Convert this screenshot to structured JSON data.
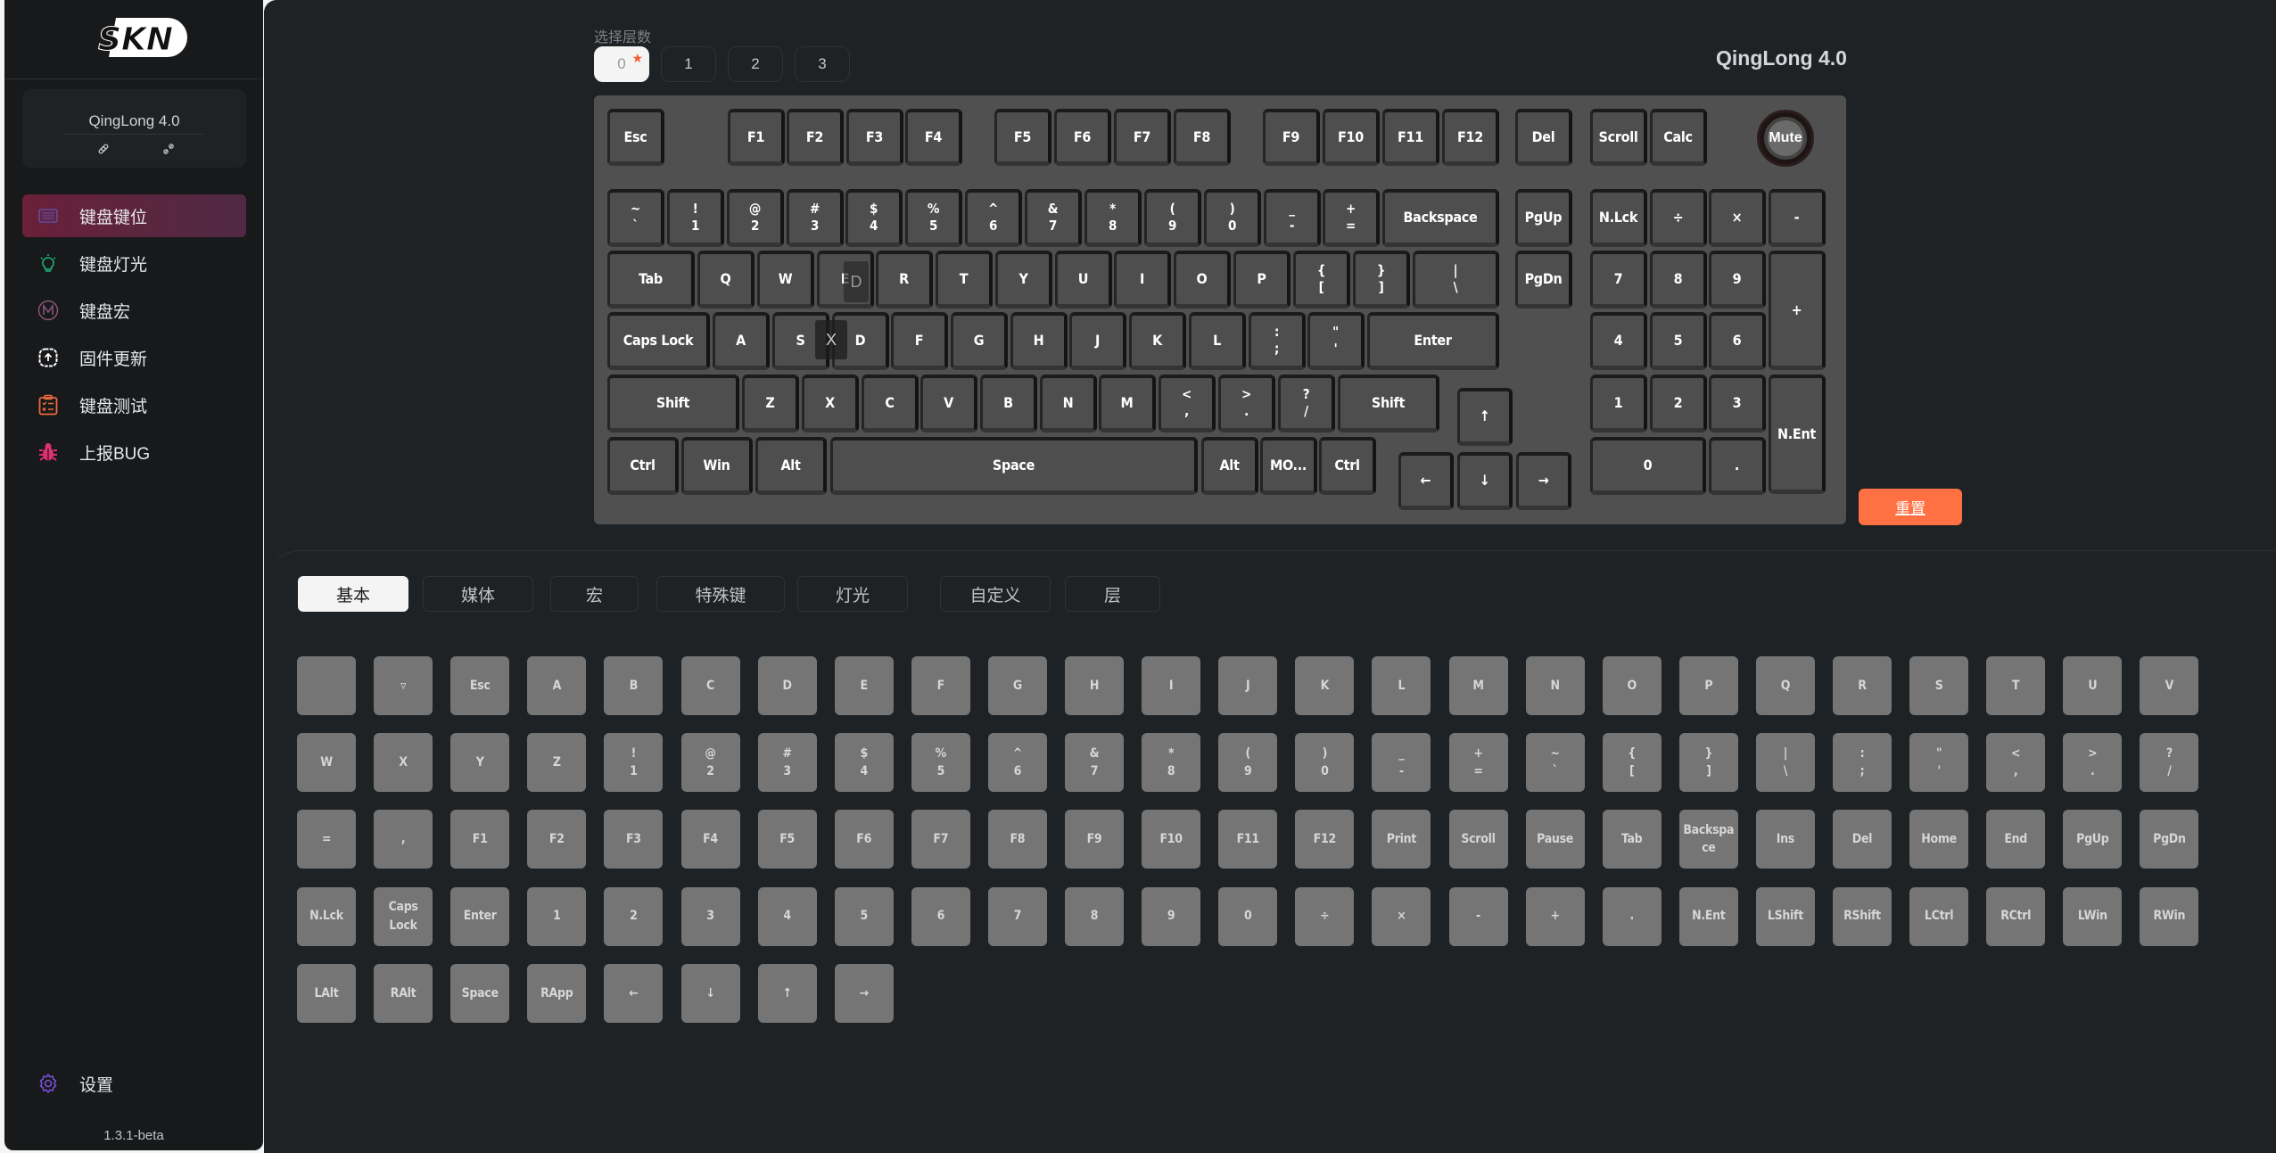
{
  "app": {
    "logo_text": "SKN",
    "version": "1.3.1-beta"
  },
  "device": {
    "name": "QingLong 4.0",
    "icons": [
      "link-icon",
      "unlink-icon"
    ]
  },
  "nav": {
    "items": [
      {
        "label": "键盘键位",
        "icon": "keyboard-icon",
        "color": "#5b4fa6",
        "active": true
      },
      {
        "label": "键盘灯光",
        "icon": "lightbulb-icon",
        "color": "#1db87a",
        "active": false
      },
      {
        "label": "键盘宏",
        "icon": "macro-m-icon",
        "color": "#8a5a7a",
        "active": false
      },
      {
        "label": "固件更新",
        "icon": "firmware-upload-icon",
        "color": "#ffffff",
        "active": false
      },
      {
        "label": "键盘测试",
        "icon": "clipboard-test-icon",
        "color": "#ef6a3c",
        "active": false
      },
      {
        "label": "上报BUG",
        "icon": "bug-icon",
        "color": "#e0306e",
        "active": false
      }
    ],
    "settings": {
      "label": "设置",
      "icon": "gear-icon",
      "color": "#7b4fd6"
    }
  },
  "layers": {
    "label": "选择层数",
    "options": [
      "0",
      "1",
      "2",
      "3"
    ],
    "selected": "0"
  },
  "keyboard": {
    "title": "QingLong 4.0",
    "knob_label": "Mute",
    "reset_label": "重置",
    "drag_ghost_labels": [
      "D",
      "X"
    ],
    "keys": [
      {
        "l": "Esc"
      },
      {
        "l": "F1"
      },
      {
        "l": "F2"
      },
      {
        "l": "F3"
      },
      {
        "l": "F4"
      },
      {
        "l": "F5"
      },
      {
        "l": "F6"
      },
      {
        "l": "F7"
      },
      {
        "l": "F8"
      },
      {
        "l": "F9"
      },
      {
        "l": "F10"
      },
      {
        "l": "F11"
      },
      {
        "l": "F12"
      },
      {
        "l": "Del"
      },
      {
        "l": "Scroll"
      },
      {
        "l": "Calc"
      },
      {
        "t": "~",
        "b": "`"
      },
      {
        "t": "!",
        "b": "1"
      },
      {
        "t": "@",
        "b": "2"
      },
      {
        "t": "#",
        "b": "3"
      },
      {
        "t": "$",
        "b": "4"
      },
      {
        "t": "%",
        "b": "5"
      },
      {
        "t": "^",
        "b": "6"
      },
      {
        "t": "&",
        "b": "7"
      },
      {
        "t": "*",
        "b": "8"
      },
      {
        "t": "(",
        "b": "9"
      },
      {
        "t": ")",
        "b": "0"
      },
      {
        "t": "_",
        "b": "-"
      },
      {
        "t": "+",
        "b": "="
      },
      {
        "l": "Backspace"
      },
      {
        "l": "PgUp"
      },
      {
        "l": "N.Lck"
      },
      {
        "l": "÷"
      },
      {
        "l": "×"
      },
      {
        "l": "-"
      },
      {
        "l": "Tab"
      },
      {
        "l": "Q"
      },
      {
        "l": "W"
      },
      {
        "l": "E"
      },
      {
        "l": "R"
      },
      {
        "l": "T"
      },
      {
        "l": "Y"
      },
      {
        "l": "U"
      },
      {
        "l": "I"
      },
      {
        "l": "O"
      },
      {
        "l": "P"
      },
      {
        "t": "{",
        "b": "["
      },
      {
        "t": "}",
        "b": "]"
      },
      {
        "t": "|",
        "b": "\\"
      },
      {
        "l": "PgDn"
      },
      {
        "l": "7"
      },
      {
        "l": "8"
      },
      {
        "l": "9"
      },
      {
        "l": "+"
      },
      {
        "l": "Caps Lock"
      },
      {
        "l": "A"
      },
      {
        "l": "S"
      },
      {
        "l": "D"
      },
      {
        "l": "F"
      },
      {
        "l": "G"
      },
      {
        "l": "H"
      },
      {
        "l": "J"
      },
      {
        "l": "K"
      },
      {
        "l": "L"
      },
      {
        "t": ":",
        "b": ";"
      },
      {
        "t": "\"",
        "b": "'"
      },
      {
        "l": "Enter"
      },
      {
        "l": "4"
      },
      {
        "l": "5"
      },
      {
        "l": "6"
      },
      {
        "l": "Shift"
      },
      {
        "l": "Z"
      },
      {
        "l": "X"
      },
      {
        "l": "C"
      },
      {
        "l": "V"
      },
      {
        "l": "B"
      },
      {
        "l": "N"
      },
      {
        "l": "M"
      },
      {
        "t": "<",
        "b": ","
      },
      {
        "t": ">",
        "b": "."
      },
      {
        "t": "?",
        "b": "/"
      },
      {
        "l": "Shift"
      },
      {
        "l": "↑"
      },
      {
        "l": "1"
      },
      {
        "l": "2"
      },
      {
        "l": "3"
      },
      {
        "l": "N.Ent"
      },
      {
        "l": "Ctrl"
      },
      {
        "l": "Win"
      },
      {
        "l": "Alt"
      },
      {
        "l": "Space"
      },
      {
        "l": "Alt"
      },
      {
        "l": "MO..."
      },
      {
        "l": "Ctrl"
      },
      {
        "l": "←"
      },
      {
        "l": "↓"
      },
      {
        "l": "→"
      },
      {
        "l": "0"
      },
      {
        "l": "."
      }
    ]
  },
  "palette": {
    "tabs": [
      "基本",
      "媒体",
      "宏",
      "特殊键",
      "灯光",
      "自定义",
      "层"
    ],
    "active_tab": "基本",
    "keys": [
      {
        "l": ""
      },
      {
        "l": "▿"
      },
      {
        "l": "Esc"
      },
      {
        "l": "A"
      },
      {
        "l": "B"
      },
      {
        "l": "C"
      },
      {
        "l": "D"
      },
      {
        "l": "E"
      },
      {
        "l": "F"
      },
      {
        "l": "G"
      },
      {
        "l": "H"
      },
      {
        "l": "I"
      },
      {
        "l": "J"
      },
      {
        "l": "K"
      },
      {
        "l": "L"
      },
      {
        "l": "M"
      },
      {
        "l": "N"
      },
      {
        "l": "O"
      },
      {
        "l": "P"
      },
      {
        "l": "Q"
      },
      {
        "l": "R"
      },
      {
        "l": "S"
      },
      {
        "l": "T"
      },
      {
        "l": "U"
      },
      {
        "l": "V"
      },
      {
        "l": "W"
      },
      {
        "l": "X"
      },
      {
        "l": "Y"
      },
      {
        "l": "Z"
      },
      {
        "t": "!",
        "b": "1"
      },
      {
        "t": "@",
        "b": "2"
      },
      {
        "t": "#",
        "b": "3"
      },
      {
        "t": "$",
        "b": "4"
      },
      {
        "t": "%",
        "b": "5"
      },
      {
        "t": "^",
        "b": "6"
      },
      {
        "t": "&",
        "b": "7"
      },
      {
        "t": "*",
        "b": "8"
      },
      {
        "t": "(",
        "b": "9"
      },
      {
        "t": ")",
        "b": "0"
      },
      {
        "t": "_",
        "b": "-"
      },
      {
        "t": "+",
        "b": "="
      },
      {
        "t": "~",
        "b": "`"
      },
      {
        "t": "{",
        "b": "["
      },
      {
        "t": "}",
        "b": "]"
      },
      {
        "t": "|",
        "b": "\\"
      },
      {
        "t": ":",
        "b": ";"
      },
      {
        "t": "\"",
        "b": "'"
      },
      {
        "t": "<",
        "b": ","
      },
      {
        "t": ">",
        "b": "."
      },
      {
        "t": "?",
        "b": "/"
      },
      {
        "l": "="
      },
      {
        "l": ","
      },
      {
        "l": "F1"
      },
      {
        "l": "F2"
      },
      {
        "l": "F3"
      },
      {
        "l": "F4"
      },
      {
        "l": "F5"
      },
      {
        "l": "F6"
      },
      {
        "l": "F7"
      },
      {
        "l": "F8"
      },
      {
        "l": "F9"
      },
      {
        "l": "F10"
      },
      {
        "l": "F11"
      },
      {
        "l": "F12"
      },
      {
        "l": "Print"
      },
      {
        "l": "Scroll"
      },
      {
        "l": "Pause"
      },
      {
        "l": "Tab"
      },
      {
        "t": "Backspa",
        "b": "ce"
      },
      {
        "l": "Ins"
      },
      {
        "l": "Del"
      },
      {
        "l": "Home"
      },
      {
        "l": "End"
      },
      {
        "l": "PgUp"
      },
      {
        "l": "PgDn"
      },
      {
        "l": "N.Lck"
      },
      {
        "t": "Caps",
        "b": "Lock"
      },
      {
        "l": "Enter"
      },
      {
        "l": "1"
      },
      {
        "l": "2"
      },
      {
        "l": "3"
      },
      {
        "l": "4"
      },
      {
        "l": "5"
      },
      {
        "l": "6"
      },
      {
        "l": "7"
      },
      {
        "l": "8"
      },
      {
        "l": "9"
      },
      {
        "l": "0"
      },
      {
        "l": "÷"
      },
      {
        "l": "×"
      },
      {
        "l": "-"
      },
      {
        "l": "+"
      },
      {
        "l": "."
      },
      {
        "l": "N.Ent"
      },
      {
        "l": "LShift"
      },
      {
        "l": "RShift"
      },
      {
        "l": "LCtrl"
      },
      {
        "l": "RCtrl"
      },
      {
        "l": "LWin"
      },
      {
        "l": "RWin"
      },
      {
        "l": "LAlt"
      },
      {
        "l": "RAlt"
      },
      {
        "l": "Space"
      },
      {
        "l": "RApp"
      },
      {
        "l": "←"
      },
      {
        "l": "↓"
      },
      {
        "l": "↑"
      },
      {
        "l": "→"
      }
    ]
  }
}
